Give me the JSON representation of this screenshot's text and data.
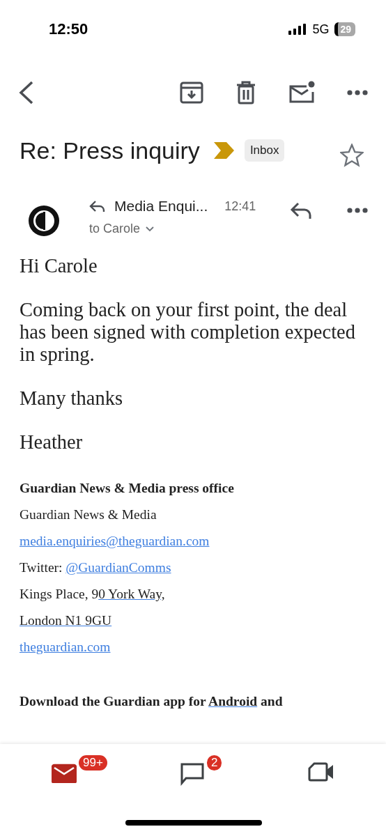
{
  "status_bar": {
    "time": "12:50",
    "network": "5G",
    "battery": "29"
  },
  "subject": {
    "title": "Re: Press inquiry",
    "important": true,
    "label": "Inbox",
    "starred": false
  },
  "message": {
    "sender": "Media Enqui...",
    "time": "12:41",
    "recipient": "to Carole"
  },
  "body": {
    "paragraphs": [
      "Hi Carole",
      "Coming back on your first point, the deal has been signed with completion expected in spring.",
      "Many thanks",
      "Heather"
    ],
    "signature": [
      [
        {
          "kind": "heading",
          "text": "Guardian News & Media press office"
        }
      ],
      [
        {
          "kind": "plain",
          "text": "Guardian News & Media"
        }
      ],
      [
        {
          "kind": "link",
          "text": "media.enquiries@theguardian.com"
        }
      ],
      [
        {
          "kind": "plain",
          "text": "Twitter: "
        },
        {
          "kind": "link",
          "text": "@GuardianComms"
        }
      ],
      [
        {
          "kind": "plain",
          "text": "Kings Place, 9"
        },
        {
          "kind": "address",
          "text": "0 York Way, "
        }
      ],
      [
        {
          "kind": "address",
          "text": "London N1 9GU"
        }
      ],
      [
        {
          "kind": "link",
          "text": "theguardian.com"
        }
      ]
    ],
    "footer": [
      {
        "kind": "heading",
        "text": "Download the Guardian app for "
      },
      {
        "kind": "heading_link",
        "text": "Android"
      },
      {
        "kind": "heading",
        "text": " and"
      }
    ]
  },
  "bottom_nav": [
    {
      "kind": "mail",
      "selected": true,
      "badge": "99+"
    },
    {
      "kind": "chat",
      "selected": false,
      "badge": "2"
    },
    {
      "kind": "meet",
      "selected": false
    }
  ]
}
